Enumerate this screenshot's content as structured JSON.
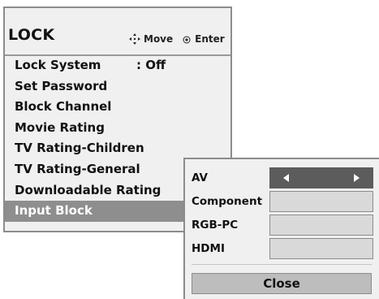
{
  "menu": {
    "title": "LOCK",
    "hints": {
      "move_label": "Move",
      "enter_label": "Enter"
    },
    "items": [
      {
        "label": "Lock System",
        "value": ": Off"
      },
      {
        "label": "Set Password"
      },
      {
        "label": "Block Channel"
      },
      {
        "label": "Movie Rating"
      },
      {
        "label": "TV Rating-Children"
      },
      {
        "label": "TV Rating-General"
      },
      {
        "label": "Downloadable Rating"
      },
      {
        "label": "Input Block",
        "selected": true
      }
    ]
  },
  "input_block": {
    "rows": [
      {
        "label": "AV",
        "active": true
      },
      {
        "label": "Component"
      },
      {
        "label": "RGB-PC"
      },
      {
        "label": "HDMI"
      }
    ],
    "close_label": "Close"
  },
  "icons": {
    "move": "four-way-arrow-icon",
    "enter": "enter-circle-icon",
    "left": "left-arrow-icon",
    "right": "right-arrow-icon"
  },
  "colors": {
    "panel_bg": "#f0f0f0",
    "selected_bg": "#8e8e8e",
    "active_box": "#5c5c5c",
    "inactive_box": "#d9d9d9",
    "close_bg": "#bdbdbd",
    "border": "#8c8c8c"
  }
}
